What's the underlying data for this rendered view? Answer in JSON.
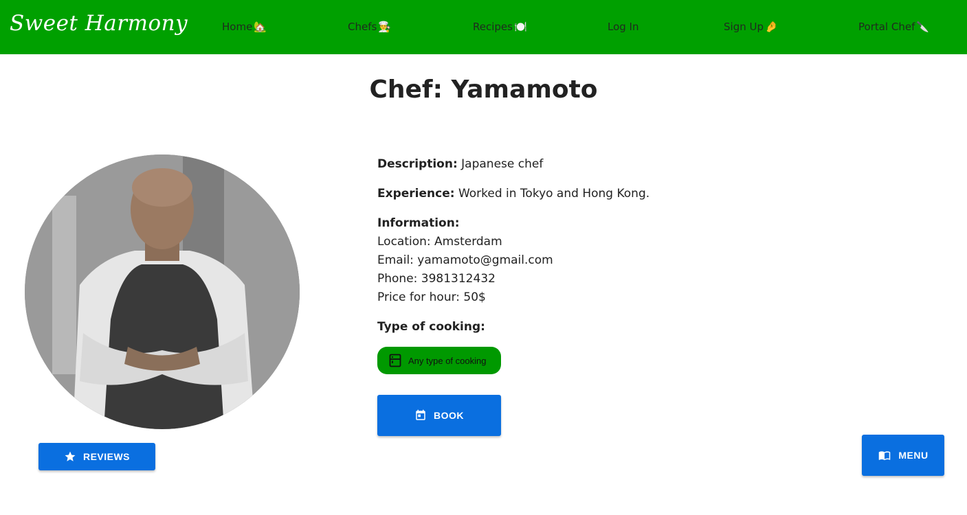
{
  "navbar": {
    "brand": "Sweet Harmony",
    "links": [
      {
        "label": "Home",
        "emoji": "🏡"
      },
      {
        "label": "Chefs",
        "emoji": "👨‍🍳"
      },
      {
        "label": "Recipes",
        "emoji": "🍽️"
      },
      {
        "label": "Log In",
        "emoji": ""
      },
      {
        "label": "Sign Up",
        "emoji": "🤌"
      },
      {
        "label": "Portal Chef",
        "emoji": "🔪"
      }
    ]
  },
  "page": {
    "title": "Chef: Yamamoto"
  },
  "profile": {
    "description_label": "Description:",
    "description": "Japanese chef",
    "experience_label": "Experience:",
    "experience": "Worked in Tokyo and Hong Kong.",
    "information_label": "Information:",
    "location": "Location: Amsterdam",
    "email": "Email: yamamoto@gmail.com",
    "phone": "Phone: 3981312432",
    "price": "Price for hour: 50$",
    "cooking_label": "Type of cooking:",
    "cooking_chip": "Any type of cooking"
  },
  "buttons": {
    "reviews": "REVIEWS",
    "book": "BOOK",
    "menu": "MENU"
  },
  "colors": {
    "navbar": "#00a000",
    "primary": "#0a6fe0",
    "chip": "#009900"
  },
  "icons": {
    "reviews": "star-icon",
    "book": "calendar-icon",
    "menu": "menu-book-icon",
    "chip": "kitchen-icon"
  }
}
